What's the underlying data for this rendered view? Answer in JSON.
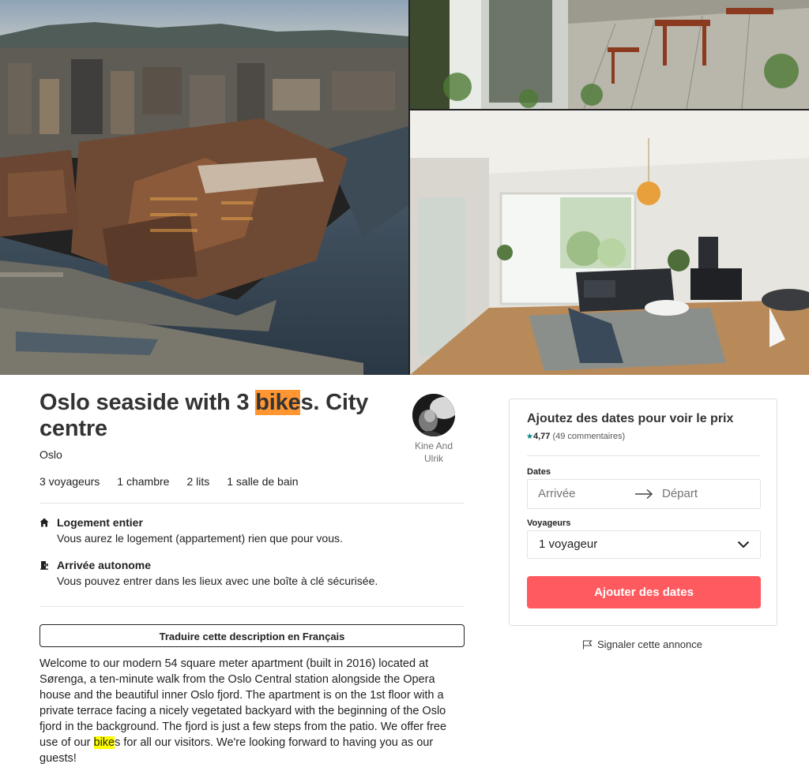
{
  "listing": {
    "title_part1": "Oslo seaside with 3 ",
    "title_highlight": "bike",
    "title_part2": "s. City centre",
    "location": "Oslo"
  },
  "host": {
    "name": "Kine And Ulrik",
    "avatar_icon": "host-avatar"
  },
  "stats": {
    "guests": "3 voyageurs",
    "bedrooms": "1 chambre",
    "beds": "2 lits",
    "bathrooms": "1 salle de bain"
  },
  "features": [
    {
      "icon": "home-icon",
      "title": "Logement entier",
      "description": "Vous aurez le logement (appartement) rien que pour vous."
    },
    {
      "icon": "door-key-icon",
      "title": "Arrivée autonome",
      "description": "Vous pouvez entrer dans les lieux avec une boîte à clé sécurisée."
    }
  ],
  "translate_label": "Traduire cette description en Français",
  "description": {
    "part1": "Welcome to our modern 54 square meter apartment (built in 2016) located at Sørenga, a ten-minute walk from the Oslo Central station alongside the Opera house and the beautiful inner Oslo fjord. The apartment is on the 1st floor with a private terrace facing a nicely vegetated backyard with the beginning of the Oslo fjord in the background. The fjord is just a few steps from the patio. We offer free use of our ",
    "highlight": "bike",
    "part2": "s for all our visitors. We're looking forward to having you as our guests!"
  },
  "booking": {
    "title": "Ajoutez des dates pour voir le prix",
    "rating_value": "4,77",
    "rating_count": "(49 commentaires)",
    "dates_label": "Dates",
    "checkin_placeholder": "Arrivée",
    "checkout_placeholder": "Départ",
    "guests_label": "Voyageurs",
    "guests_value": "1 voyageur",
    "cta_label": "Ajouter des dates"
  },
  "report_label": "Signaler cette annonce",
  "colors": {
    "brand": "#ff5a5f",
    "rating_star": "#008489",
    "find_highlight_current": "#ff9632",
    "find_highlight": "#ffff00"
  },
  "images": [
    "aerial-oslo-waterfront-photo",
    "terrace-photo",
    "living-room-photo"
  ]
}
